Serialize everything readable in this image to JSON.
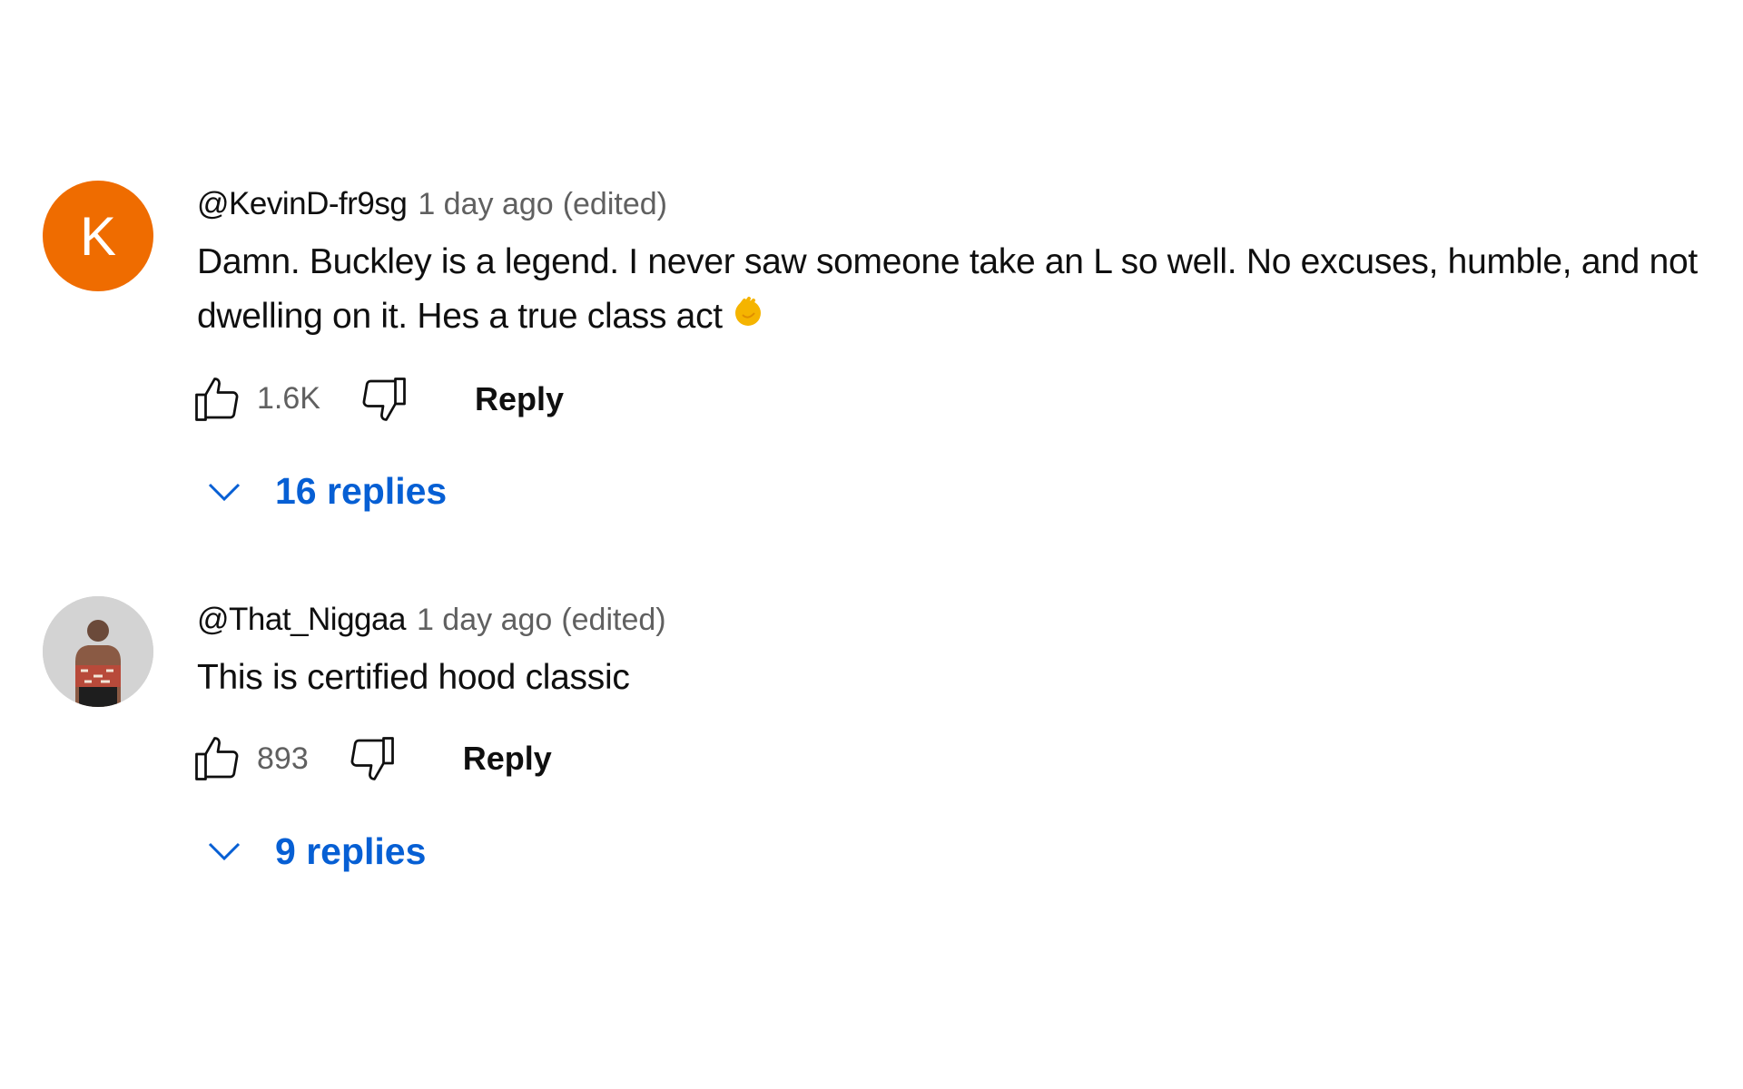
{
  "comments": [
    {
      "avatar_letter": "K",
      "avatar_color": "#ef6c00",
      "author": "@KevinD-fr9sg",
      "time": "1 day ago",
      "edited": "(edited)",
      "text": "Damn. Buckley is a legend. I never saw someone take an L so well. No excuses, humble, and not dwelling on it. Hes a true class act",
      "emoji": "clapping-hands",
      "likes": "1.6K",
      "reply_label": "Reply",
      "replies_label": "16 replies"
    },
    {
      "avatar_letter": "",
      "author": "@That_Niggaa",
      "time": "1 day ago",
      "edited": "(edited)",
      "text": "This is certified hood classic",
      "likes": "893",
      "reply_label": "Reply",
      "replies_label": "9 replies"
    }
  ],
  "colors": {
    "link_blue": "#065fd4",
    "meta_gray": "#606060"
  }
}
